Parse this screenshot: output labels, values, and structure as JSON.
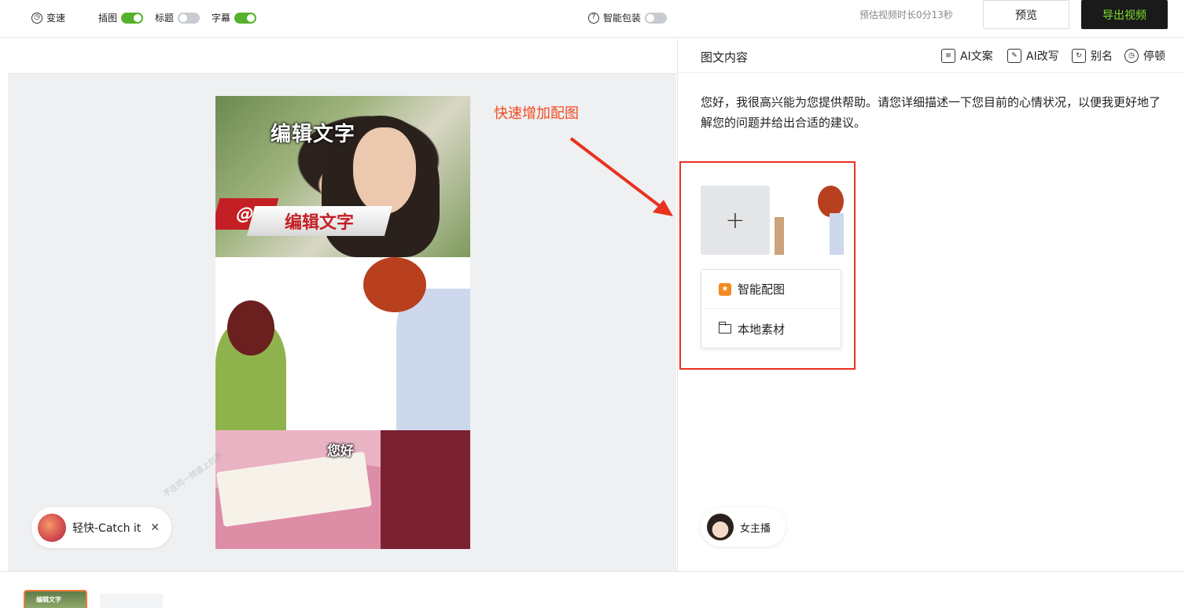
{
  "topbar": {
    "duration": "预估视频时长0分13秒",
    "preview_label": "预览",
    "export_label": "导出视频"
  },
  "left_toolbar": {
    "speed": "变速",
    "insert_image": {
      "label": "插图",
      "on": true
    },
    "title": {
      "label": "标题",
      "on": false
    },
    "subtitle": {
      "label": "字幕",
      "on": true
    },
    "smart_pack": {
      "label": "智能包装",
      "on": false
    }
  },
  "video": {
    "title_text": "编辑文字",
    "at_symbol": "@",
    "banner_text": "编辑文字",
    "subtitle_text": "您好"
  },
  "watermark_text": "不在同一频道上的不",
  "annotation": "快速增加配图",
  "music": {
    "label": "轻快-Catch it",
    "close": "✕"
  },
  "right": {
    "title": "图文内容",
    "actions": [
      {
        "label": "AI文案",
        "icon": "ai-copy-icon"
      },
      {
        "label": "AI改写",
        "icon": "ai-rewrite-icon"
      },
      {
        "label": "别名",
        "icon": "alias-icon"
      },
      {
        "label": "停顿",
        "icon": "clock-icon"
      }
    ],
    "content": "您好，我很高兴能为您提供帮助。请您详细描述一下您目前的心情状况，以便我更好地了解您的问题并给出合适的建议。",
    "add_symbol": "+",
    "menu": [
      {
        "label": "智能配图",
        "icon": "smart-image-icon"
      },
      {
        "label": "本地素材",
        "icon": "folder-icon"
      }
    ],
    "anchor_label": "女主播"
  },
  "timeline": {
    "thumb_text": "编辑文字"
  },
  "colors": {
    "accent_green": "#55b22a",
    "export_text": "#7ee02b",
    "annotation_red": "#e8321e",
    "highlight_orange": "#f07a36"
  }
}
